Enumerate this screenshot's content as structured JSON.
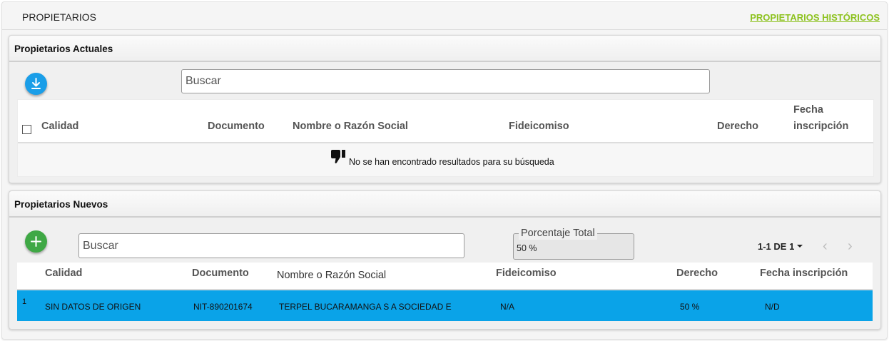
{
  "header": {
    "title": "PROPIETARIOS",
    "historic_link": "PROPIETARIOS HISTÓRICOS"
  },
  "current_owners": {
    "title": "Propietarios Actuales",
    "download_icon": "download-icon",
    "search_placeholder": "Buscar",
    "columns": {
      "calidad": "Calidad",
      "documento": "Documento",
      "nombre": "Nombre o Razón Social",
      "fideicomiso": "Fideicomiso",
      "derecho": "Derecho",
      "fecha_line1": "Fecha",
      "fecha_line2": "inscripción"
    },
    "empty_icon": "thumbs-down-icon",
    "empty_message": "No se han encontrado resultados para su búsqueda"
  },
  "new_owners": {
    "title": "Propietarios Nuevos",
    "add_icon": "plus-icon",
    "search_placeholder": "Buscar",
    "percentage": {
      "label": "Porcentaje Total",
      "value": "50 %"
    },
    "pagination": {
      "label": "1-1 DE 1",
      "prev_icon": "chevron-left-icon",
      "next_icon": "chevron-right-icon"
    },
    "columns": {
      "calidad": "Calidad",
      "documento": "Documento",
      "nombre": "Nombre o Razón Social",
      "fideicomiso": "Fideicomiso",
      "derecho": "Derecho",
      "fecha": "Fecha inscripción"
    },
    "rows": [
      {
        "index": "1",
        "calidad": "SIN DATOS DE ORIGEN",
        "documento": "NIT-890201674",
        "nombre": "TERPEL BUCARAMANGA S A SOCIEDAD E",
        "fideicomiso": "N/A",
        "derecho": "50 %",
        "fecha": "N/D"
      }
    ]
  },
  "colors": {
    "link_green": "#8dc21f",
    "download_blue": "#1a9ee8",
    "add_green": "#3fa845",
    "selected_row": "#0aa3e8"
  }
}
